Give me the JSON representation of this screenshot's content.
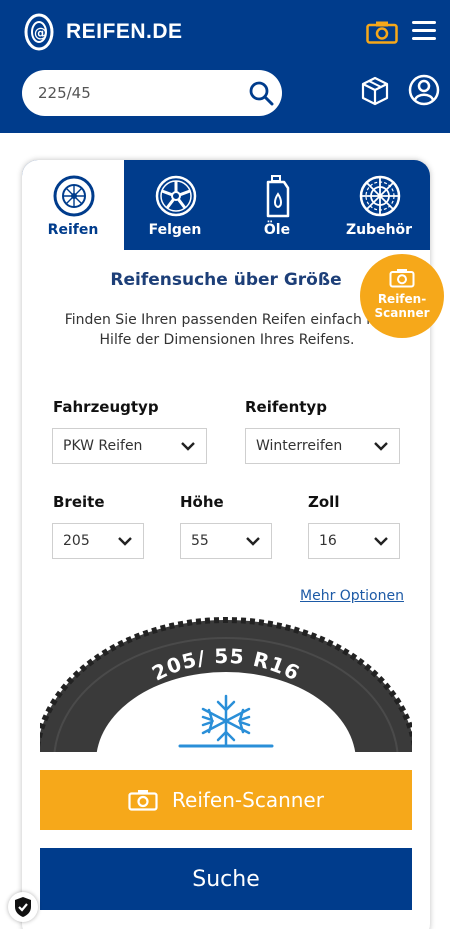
{
  "header": {
    "logo_text": "REIFEN.DE",
    "search_value": "225/45",
    "icons": [
      "camera-icon",
      "menu-icon",
      "search-icon",
      "box-icon",
      "user-icon"
    ]
  },
  "tabs": [
    {
      "label": "Reifen",
      "icon": "tire-icon",
      "active": true
    },
    {
      "label": "Felgen",
      "icon": "rim-icon",
      "active": false
    },
    {
      "label": "Öle",
      "icon": "oil-can-icon",
      "active": false
    },
    {
      "label": "Zubehör",
      "icon": "snow-chain-icon",
      "active": false
    }
  ],
  "main": {
    "title": "Reifensuche über Größe",
    "description": "Finden Sie Ihren passenden Reifen einfach mit Hilfe der Dimensionen Ihres Reifens.",
    "scanner_badge": "Reifen-Scanner",
    "fahrzeugtyp_label": "Fahrzeugtyp",
    "fahrzeugtyp_value": "PKW Reifen",
    "reifentyp_label": "Reifentyp",
    "reifentyp_value": "Winterreifen",
    "breite_label": "Breite",
    "breite_value": "205",
    "hoehe_label": "Höhe",
    "hoehe_value": "55",
    "zoll_label": "Zoll",
    "zoll_value": "16",
    "more_options": "Mehr Optionen",
    "tire_text": "205/ 55 R16",
    "scanner_button": "Reifen-Scanner",
    "search_button": "Suche"
  },
  "colors": {
    "brand_blue": "#003c8c",
    "accent_orange": "#f6a81a",
    "link_blue": "#1d5aa6",
    "snowflake": "#2a8fd8"
  }
}
